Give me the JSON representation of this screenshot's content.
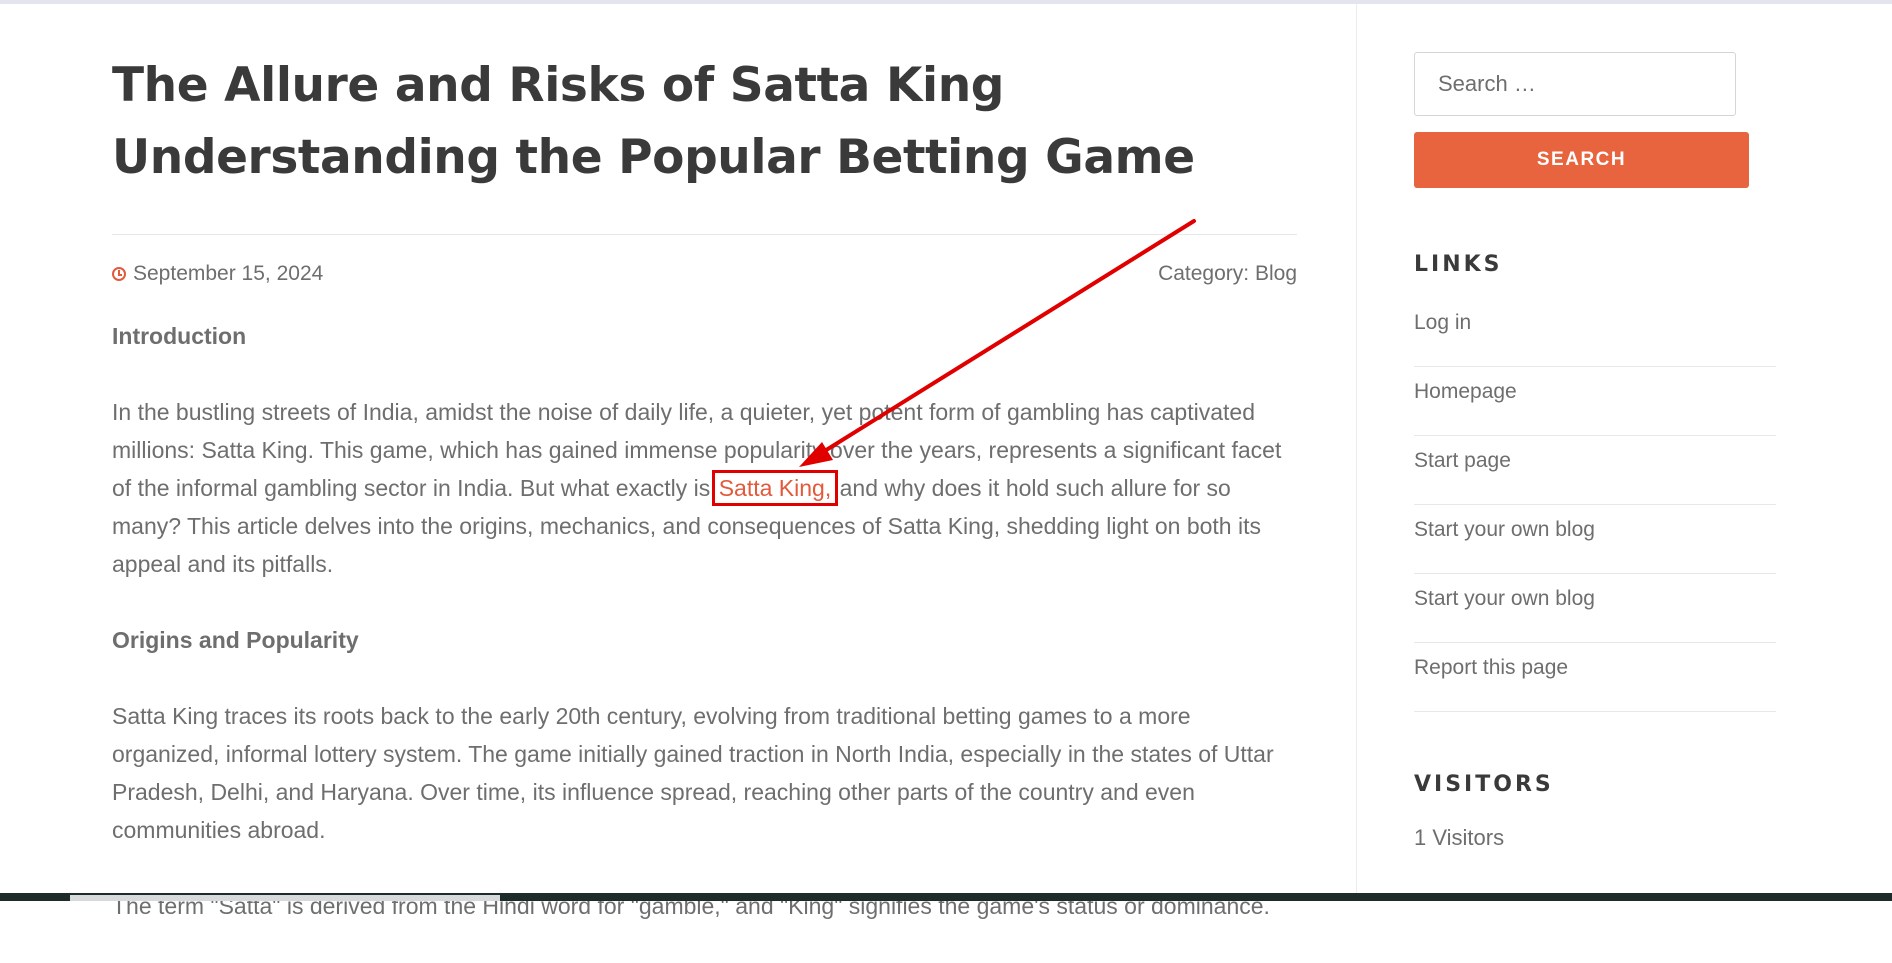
{
  "post": {
    "title": "The Allure and Risks of Satta King Understanding the Popular Betting Game",
    "date": "September 15, 2024",
    "category_label": "Category:",
    "category": "Blog"
  },
  "content": {
    "intro_heading": "Introduction",
    "intro_p_before": "In the bustling streets of India, amidst the noise of daily life, a quieter, yet potent form of gambling has captivated millions: Satta King. This game, which has gained immense popularity over the years, represents a significant facet of the informal gambling sector in India. But what exactly is ",
    "intro_link": "Satta King,",
    "intro_p_after": " and why does it hold such allure for so many? This article delves into the origins, mechanics, and consequences of Satta King, shedding light on both its appeal and its pitfalls.",
    "origins_heading": "Origins and Popularity",
    "origins_p": "Satta King traces its roots back to the early 20th century, evolving from traditional betting games to a more organized, informal lottery system. The game initially gained traction in North India, especially in the states of Uttar Pradesh, Delhi, and Haryana. Over time, its influence spread, reaching other parts of the country and even communities abroad.",
    "term_p": "The term \"Satta\" is derived from the Hindi word for \"gamble,\" and \"King\" signifies the game's status or dominance."
  },
  "sidebar": {
    "search_placeholder": "Search …",
    "search_button": "SEARCH",
    "links_title": "LINKS",
    "links": [
      {
        "label": "Log in"
      },
      {
        "label": "Homepage"
      },
      {
        "label": "Start page"
      },
      {
        "label": "Start your own blog"
      },
      {
        "label": "Start your own blog"
      },
      {
        "label": "Report this page"
      }
    ],
    "visitors_title": "VISITORS",
    "visitors_count": "1 Visitors"
  },
  "colors": {
    "accent": "#e25a3b",
    "search_button": "#e7643f",
    "annotation": "#e00000",
    "heading": "#3a3a3a",
    "text": "#6e6e6e"
  },
  "icons": {
    "date": "clock-icon"
  }
}
